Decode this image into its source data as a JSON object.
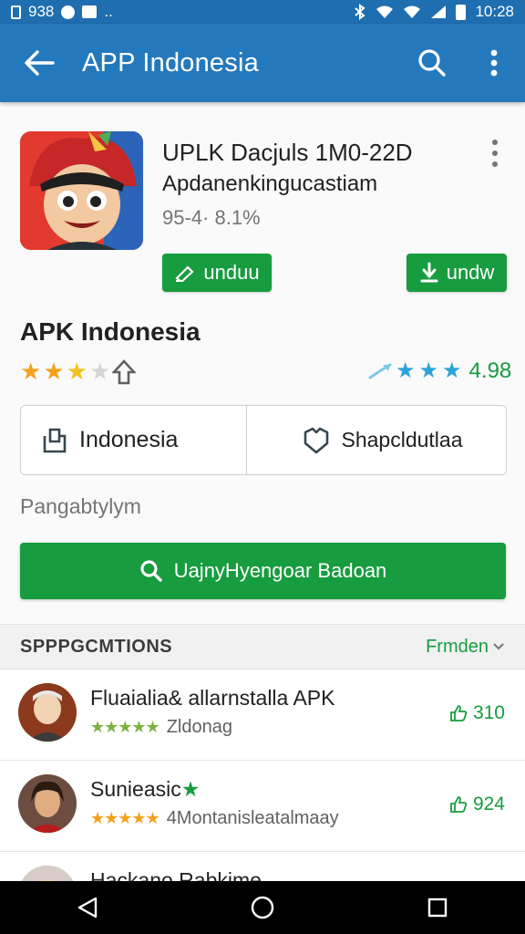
{
  "status_bar": {
    "left_text": "938",
    "left_extra": "..",
    "time": "10:28",
    "icons": [
      "sim-icon",
      "notification-icon",
      "image-icon",
      "bluetooth-icon",
      "wifi-icon",
      "wifi-icon",
      "signal-icon",
      "battery-icon"
    ]
  },
  "app_bar": {
    "title": "APP Indonesia",
    "icons": [
      "back-arrow-icon",
      "search-icon",
      "more-vert-icon"
    ]
  },
  "header": {
    "app_name": "UPLK Dacjuls 1M0-22D",
    "developer": "Apdanenkingucastiam",
    "meta": "95-4· 8.1%",
    "left_button": "unduu",
    "right_button": "undw"
  },
  "section": {
    "title": "APK Indonesia",
    "rating_value": "4.98",
    "stars": 2.5
  },
  "split": {
    "left_label": "Indonesia",
    "right_label": "Shapcldutlaa"
  },
  "caption": "Pangabtylym",
  "main_button": {
    "label": "UajnyHyengoar Badoan"
  },
  "suggestions": {
    "title": "SPPPGCMTIONS",
    "link": "Frmden"
  },
  "list": [
    {
      "title": "Fluaialia& allarnstalla APK",
      "subtitle": "Zldonag",
      "count": "310",
      "stars": "★★★★★"
    },
    {
      "title": "Sunieasic",
      "title_suffix": "★",
      "subtitle": "4Montanisleatalmaay",
      "count": "924",
      "stars": "★★★★★"
    },
    {
      "title": "Hackano Rabkime",
      "subtitle": "",
      "count": "",
      "stars": ""
    }
  ],
  "colors": {
    "app_bar": "#2479bd",
    "status_bar": "#1e6eb0",
    "accent_green": "#179c3f",
    "star": "#f4a21c"
  }
}
